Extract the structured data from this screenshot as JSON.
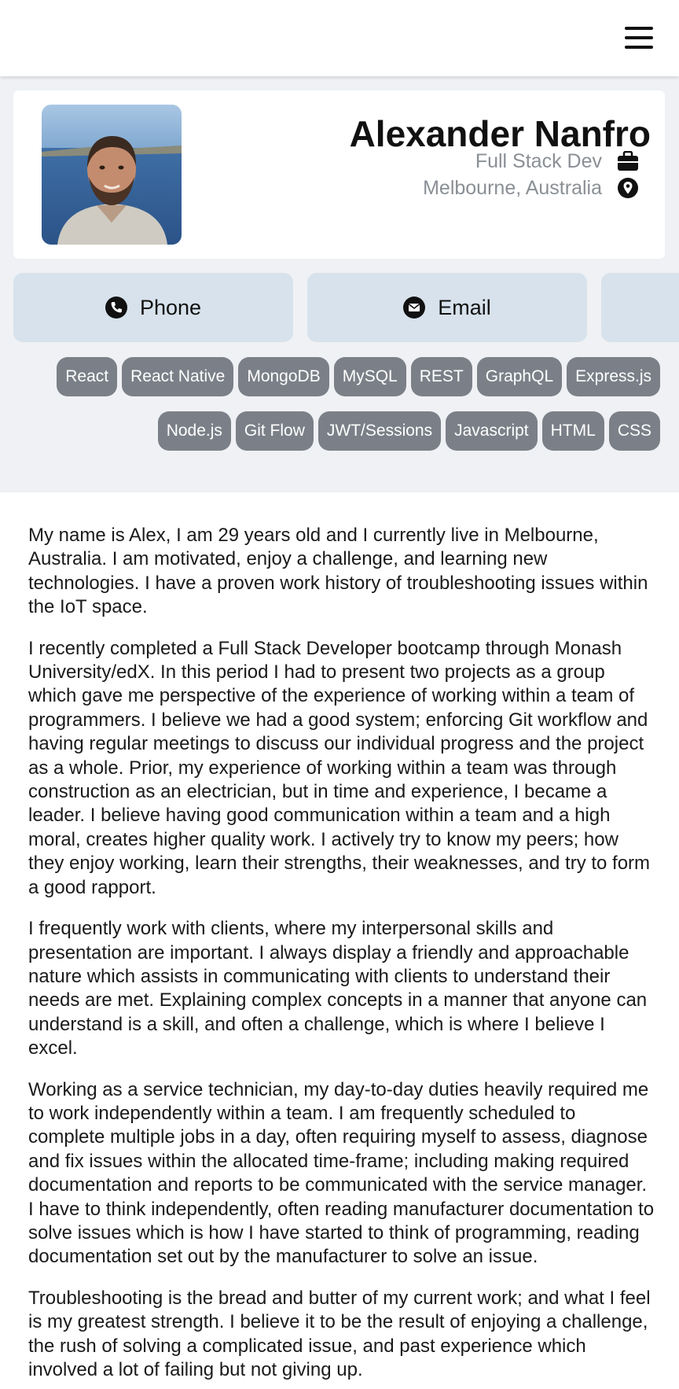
{
  "nav": {
    "menu_icon": "hamburger-menu-icon"
  },
  "profile": {
    "name": "Alexander Nanfro",
    "role": "Full Stack Dev",
    "location": "Melbourne, Australia",
    "role_icon": "briefcase-icon",
    "location_icon": "map-pin-icon",
    "avatar_alt": "profile photo"
  },
  "contacts": {
    "phone_label": "Phone",
    "email_label": "Email",
    "phone_icon": "phone-icon",
    "email_icon": "envelope-icon"
  },
  "skills": {
    "row1": [
      "React",
      "React Native",
      "MongoDB",
      "MySQL",
      "REST",
      "GraphQL",
      "Express.js"
    ],
    "row2": [
      "Node.js",
      "Git Flow",
      "JWT/Sessions",
      "Javascript",
      "HTML",
      "CSS"
    ]
  },
  "about": [
    "My name is Alex, I am 29 years old and I currently live in Melbourne, Australia. I am motivated, enjoy a challenge, and learning new technologies. I have a proven work history of troubleshooting issues within the IoT space.",
    "I recently completed a Full Stack Developer bootcamp through Monash University/edX. In this period I had to present two projects as a group which gave me perspective of the experience of working within a team of programmers. I believe we had a good system; enforcing Git workflow and having regular meetings to discuss our individual progress and the project as a whole. Prior, my experience of working within a team was through construction as an electrician, but in time and experience, I became a leader. I believe having good communication within a team and a high moral, creates higher quality work. I actively try to know my peers; how they enjoy working, learn their strengths, their weaknesses, and try to form a good rapport.",
    "I frequently work with clients, where my interpersonal skills and presentation are important. I always display a friendly and approachable nature which assists in communicating with clients to understand their needs are met. Explaining complex concepts in a manner that anyone can understand is a skill, and often a challenge, which is where I believe I excel.",
    "Working as a service technician, my day-to-day duties heavily required me to work independently within a team. I am frequently scheduled to complete multiple jobs in a day, often requiring myself to assess, diagnose and fix issues within the allocated time-frame; including making required documentation and reports to be communicated with the service manager. I have to think independently, often reading manufacturer documentation to solve issues which is how I have started to think of programming, reading documentation set out by the manufacturer to solve an issue.",
    "Troubleshooting is the bread and butter of my current work; and what I feel is my greatest strength. I believe it to be the result of enjoying a challenge, the rush of solving a complicated issue, and past experience which involved a lot of failing but not giving up."
  ]
}
